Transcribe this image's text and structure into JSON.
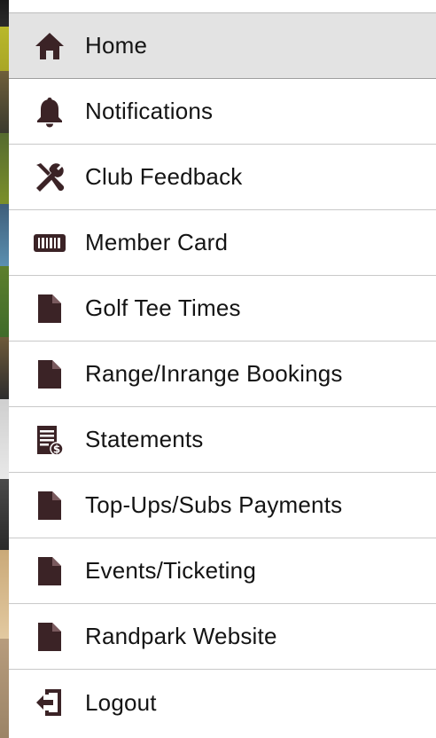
{
  "colors": {
    "icon": "#3b2326",
    "active_bg": "#e3e3e3",
    "divider": "#c9c9c9"
  },
  "menu": {
    "items": [
      {
        "label": "Home",
        "icon": "home-icon",
        "active": true
      },
      {
        "label": "Notifications",
        "icon": "bell-icon"
      },
      {
        "label": "Club Feedback",
        "icon": "tools-icon"
      },
      {
        "label": "Member Card",
        "icon": "barcode-card-icon"
      },
      {
        "label": "Golf Tee Times",
        "icon": "document-icon"
      },
      {
        "label": "Range/Inrange Bookings",
        "icon": "document-icon"
      },
      {
        "label": "Statements",
        "icon": "statement-icon"
      },
      {
        "label": "Top-Ups/Subs Payments",
        "icon": "document-icon"
      },
      {
        "label": "Events/Ticketing",
        "icon": "document-icon"
      },
      {
        "label": "Randpark Website",
        "icon": "document-icon"
      },
      {
        "label": "Logout",
        "icon": "logout-icon"
      }
    ]
  }
}
